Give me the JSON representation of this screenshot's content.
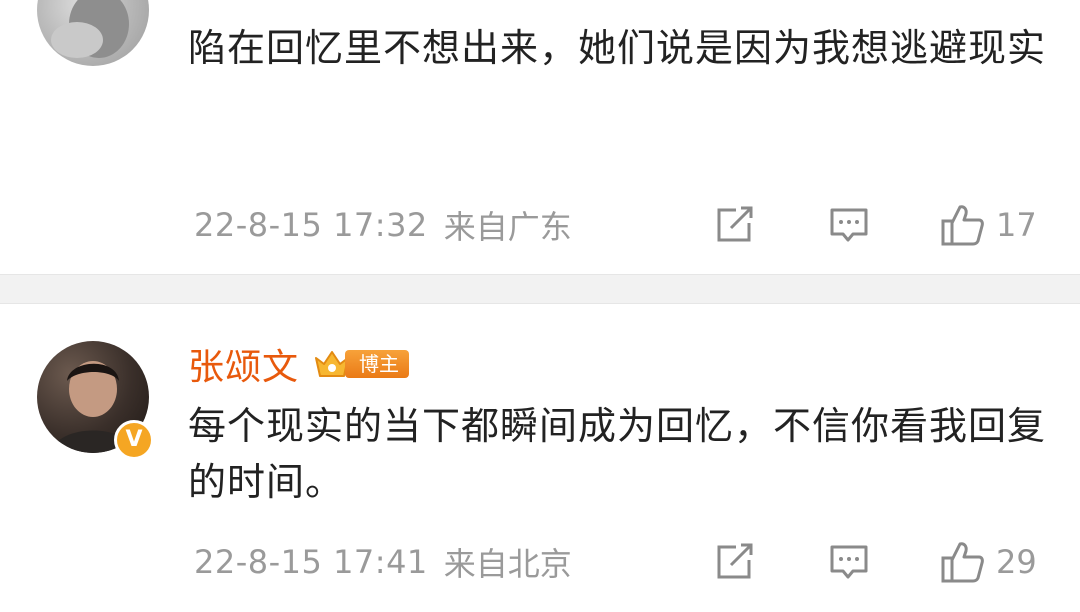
{
  "comments": [
    {
      "author": "",
      "text": "陷在回忆里不想出来，她们说是因为我想逃避现实",
      "time": "22-8-15 17:32",
      "location": "来自广东",
      "likes": "17",
      "icons": [
        "share-icon",
        "reply-icon",
        "thumbs-up-icon"
      ]
    },
    {
      "author": "张颂文",
      "badge": "博主",
      "verified_symbol": "V",
      "text": "每个现实的当下都瞬间成为回忆，不信你看我回复的时间。",
      "time": "22-8-15 17:41",
      "location": "来自北京",
      "likes": "29",
      "icons": [
        "share-icon",
        "reply-icon",
        "thumbs-up-icon"
      ]
    }
  ],
  "colors": {
    "author_name": "#e8590c",
    "badge": "#ea7a16",
    "meta_text": "#9a9a9a",
    "body_text": "#222222",
    "separator": "#f2f2f2"
  }
}
